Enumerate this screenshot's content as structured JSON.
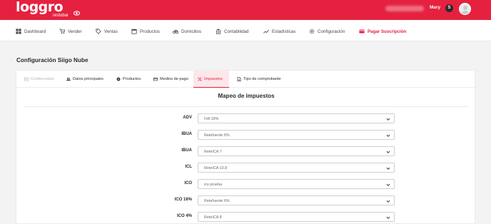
{
  "brand": {
    "logo_text": "loggro",
    "logo_subtext": "restobar",
    "color": "#e5213f"
  },
  "user": {
    "name": "Mary",
    "badge": "S"
  },
  "nav": [
    {
      "label": "Dashboard",
      "icon": "dashboard-icon"
    },
    {
      "label": "Vender",
      "icon": "cart-icon"
    },
    {
      "label": "Ventas",
      "icon": "tag-icon"
    },
    {
      "label": "Productos",
      "icon": "box-icon"
    },
    {
      "label": "Domicilios",
      "icon": "bicycle-icon"
    },
    {
      "label": "Contabilidad",
      "icon": "building-icon"
    },
    {
      "label": "Estadísticas",
      "icon": "chart-line-icon"
    },
    {
      "label": "Configuración",
      "icon": "gear-icon"
    },
    {
      "label": "Pagar Suscripción",
      "icon": "credit-card-icon",
      "highlight": true
    }
  ],
  "page": {
    "title": "Configuración Siigo Nube"
  },
  "tabs": [
    {
      "label": "Credenciales",
      "icon": "key-icon",
      "state": "disabled"
    },
    {
      "label": "Datos principales",
      "icon": "users-icon",
      "state": "normal"
    },
    {
      "label": "Productos",
      "icon": "box-icon",
      "state": "normal"
    },
    {
      "label": "Medios de pago",
      "icon": "credit-card-icon",
      "state": "normal"
    },
    {
      "label": "Impuestos",
      "icon": "percent-icon",
      "state": "active"
    },
    {
      "label": "Tipo de comprobante",
      "icon": "document-icon",
      "state": "normal"
    }
  ],
  "section": {
    "title": "Mapeo de impuestos"
  },
  "tax_mappings": [
    {
      "label": "ADV",
      "value": "IVA 19%"
    },
    {
      "label": "IBUA",
      "value": "Retefuente 6%"
    },
    {
      "label": "IBUA",
      "value": "ReteICA 7"
    },
    {
      "label": "ICL",
      "value": "ReteICA 13.8"
    },
    {
      "label": "ICO",
      "value": "ico prueba"
    },
    {
      "label": "ICO 16%",
      "value": "Retefuente 6%"
    },
    {
      "label": "ICO 4%",
      "value": "ReteICA 8"
    }
  ]
}
